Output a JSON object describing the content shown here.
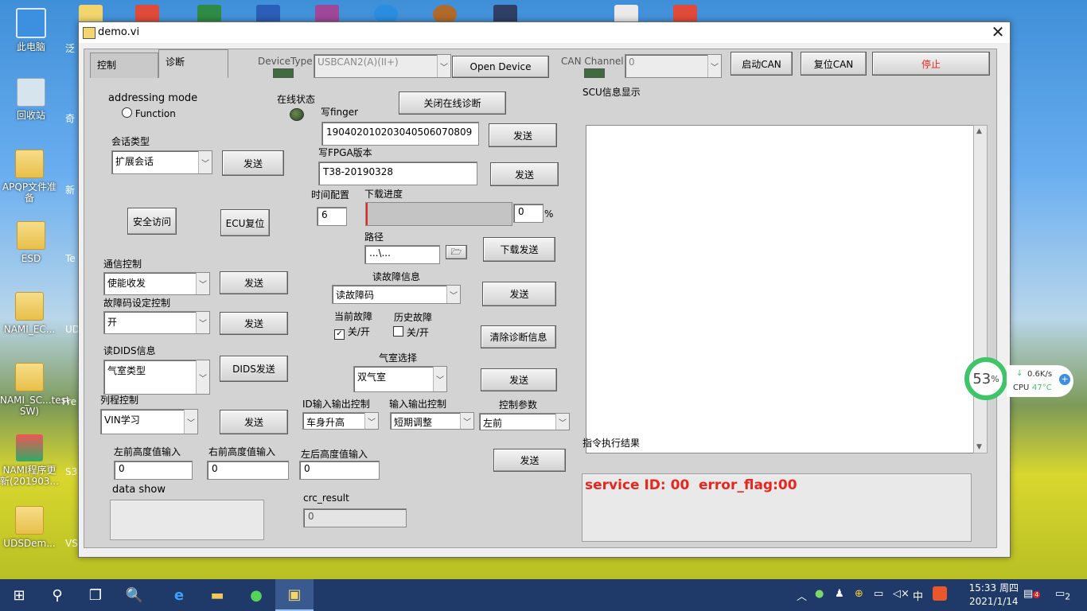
{
  "desktop": {
    "icons": [
      {
        "label": "此电脑"
      },
      {
        "label": "回收站"
      },
      {
        "label": "APQP文件准备"
      },
      {
        "label": "ESD"
      },
      {
        "label": "NAMI_EC..."
      },
      {
        "label": "NAMI_SC...test SW)"
      },
      {
        "label": "NAMI程序更新(201903..."
      },
      {
        "label": "UDSDem..."
      }
    ],
    "second_column": [
      {
        "label": "泛"
      },
      {
        "label": "奇"
      },
      {
        "label": "新"
      },
      {
        "label": "Te"
      },
      {
        "label": "UD"
      },
      {
        "label": "Fre 文"
      },
      {
        "label": "S3"
      },
      {
        "label": "VS 完"
      }
    ]
  },
  "window": {
    "title": "demo.vi",
    "close_glyph": "✕"
  },
  "tabs": {
    "control": "控制",
    "diagnose": "诊断"
  },
  "device": {
    "type_label": "DeviceType",
    "type_value": "USBCAN2(A)(II+)",
    "open_button": "Open Device",
    "channel_label": "CAN Channel",
    "channel_value": "0",
    "start_can": "启动CAN",
    "reset_can": "复位CAN",
    "stop": "停止"
  },
  "diag": {
    "addressing_mode": "addressing mode",
    "function_radio": "Function",
    "online_status": "在线状态",
    "close_online": "关闭在线诊断",
    "session_type_label": "会话类型",
    "session_type_value": "扩展会话",
    "send": "发送",
    "security_access": "安全访问",
    "ecu_reset": "ECU复位",
    "comm_ctrl_label": "通信控制",
    "comm_ctrl_value": "使能收发",
    "dtc_setting_label": "故障码设定控制",
    "dtc_setting_value": "开",
    "read_dids_label": "读DIDS信息",
    "read_dids_value": "气室类型",
    "dids_send": "DIDS发送",
    "routine_label": "列程控制",
    "routine_value": "VIN学习",
    "write_finger_label": "写finger",
    "write_finger_value": "19040201020304050607080​9",
    "write_fpga_label": "写FPGA版本",
    "write_fpga_value": "T38-20190328",
    "time_config_label": "时间配置",
    "time_config_value": "6",
    "download_progress_label": "下载进度",
    "download_progress_value": "0",
    "download_progress": 0,
    "percent": "%",
    "path_label": "路径",
    "path_value": "...\\...",
    "download_send": "下载发送",
    "read_dtc_label": "读故障信息",
    "read_dtc_value": "读故障码",
    "current_fault_label": "当前故障",
    "history_fault_label": "历史故障",
    "onoff": "关/开",
    "clear_diag": "清除诊断信息",
    "chamber_label": "气室选择",
    "chamber_value": "双气室",
    "io_id_label": "ID输入输出控制",
    "io_id_value": "车身升高",
    "io_ctrl_label": "输入输出控制",
    "io_ctrl_value": "短期调整",
    "ctrl_param_label": "控制参数",
    "ctrl_param_value": "左前",
    "lf_label": "左前高度值输入",
    "lf_value": "0",
    "rf_label": "右前高度值输入",
    "rf_value": "0",
    "lr_label": "左后高度值输入",
    "lr_value": "0",
    "data_show_label": "data show",
    "crc_label": "crc_result",
    "crc_value": "0"
  },
  "scu": {
    "label": "SCU信息显示",
    "result_label": "指令执行结果",
    "service_id": "service ID: 00",
    "error_flag": "error_flag:00"
  },
  "perf": {
    "percent": "53",
    "unit": "%",
    "net": "0.6K/s",
    "cpu_label": "CPU",
    "cpu_temp": "47°C"
  },
  "taskbar": {
    "time": "15:33 周四",
    "date": "2021/1/14",
    "ime": "中",
    "notif_count": "2",
    "badge": "4"
  }
}
